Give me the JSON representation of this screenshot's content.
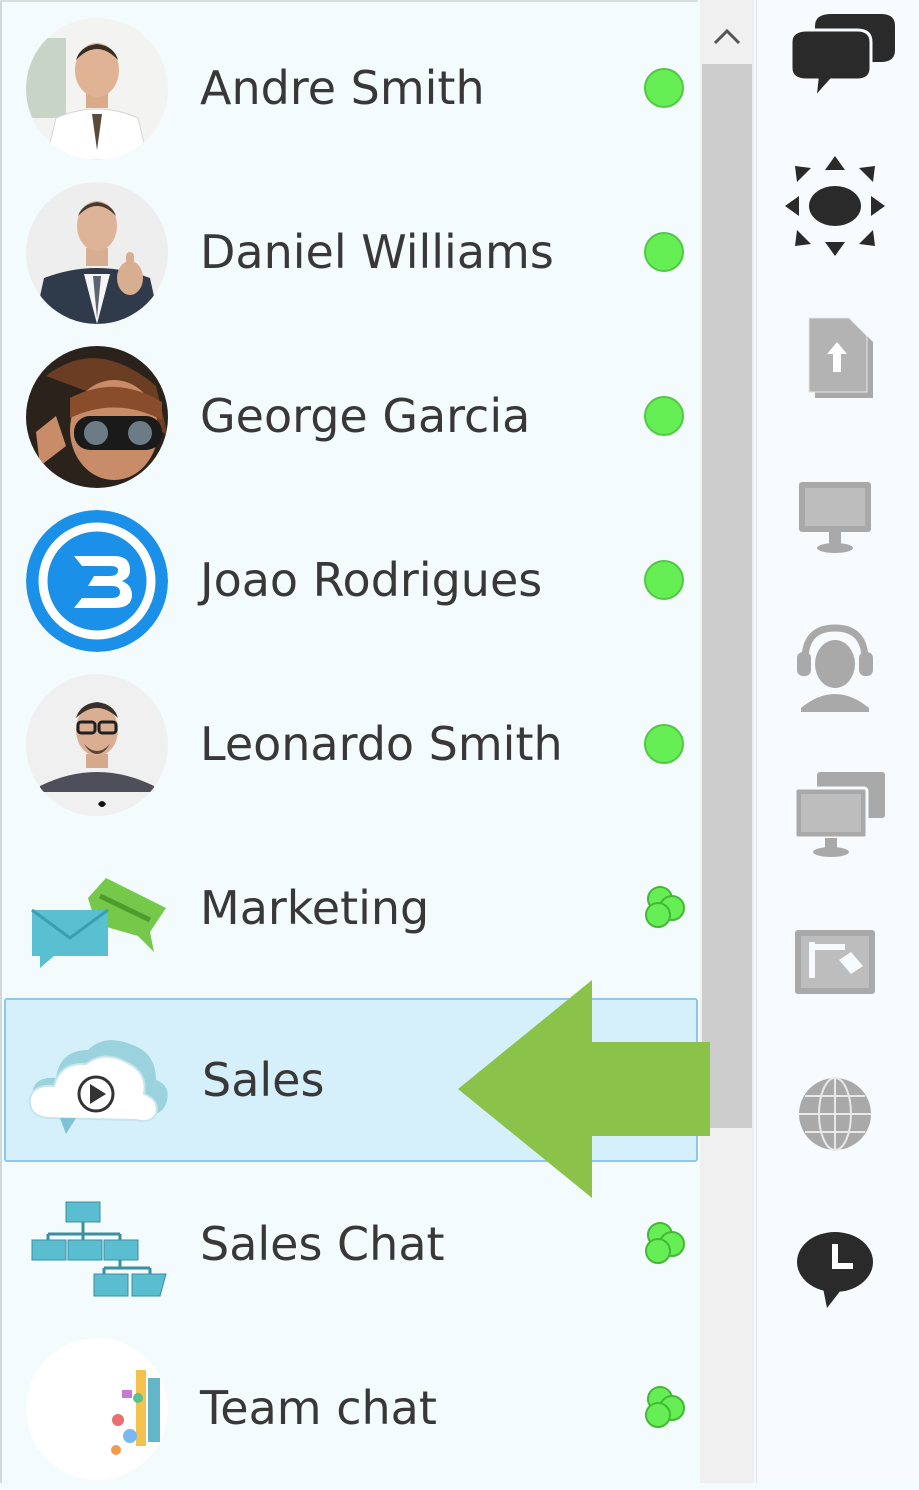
{
  "contacts": [
    {
      "name": "Andre Smith",
      "avatar_icon": "person-white-shirt-photo",
      "status": "online",
      "status_icon": "online-dot-icon"
    },
    {
      "name": "Daniel Williams",
      "avatar_icon": "person-suit-thumbs-up-photo",
      "status": "online",
      "status_icon": "online-dot-icon"
    },
    {
      "name": "George Garcia",
      "avatar_icon": "person-goggles-photo",
      "status": "online",
      "status_icon": "online-dot-icon"
    },
    {
      "name": "Joao Rodrigues",
      "avatar_icon": "blue-b-logo",
      "status": "online",
      "status_icon": "online-dot-icon"
    },
    {
      "name": "Leonardo Smith",
      "avatar_icon": "person-glasses-photo",
      "status": "online",
      "status_icon": "online-dot-icon"
    },
    {
      "name": "Marketing",
      "avatar_icon": "envelope-chat-icon",
      "status": "group",
      "status_icon": "group-dots-icon"
    },
    {
      "name": "Sales",
      "avatar_icon": "cloud-play-icon",
      "status": "selected",
      "status_icon": ""
    },
    {
      "name": "Sales Chat",
      "avatar_icon": "org-chart-icon",
      "status": "group",
      "status_icon": "group-dots-icon"
    },
    {
      "name": "Team chat",
      "avatar_icon": "team-illustration-icon",
      "status": "group",
      "status_icon": "group-dots-icon"
    }
  ],
  "toolbar": [
    {
      "icon": "chat-bubbles-icon",
      "active": true
    },
    {
      "icon": "expand-chat-icon",
      "active": true
    },
    {
      "icon": "file-upload-icon",
      "active": false
    },
    {
      "icon": "monitor-icon",
      "active": false
    },
    {
      "icon": "headset-agent-icon",
      "active": false
    },
    {
      "icon": "screen-share-icon",
      "active": false
    },
    {
      "icon": "whiteboard-icon",
      "active": false
    },
    {
      "icon": "globe-icon",
      "active": false
    },
    {
      "icon": "clock-chat-icon",
      "active": true
    }
  ],
  "colors": {
    "online": "#66ee55",
    "selection_bg": "#d6f0fb",
    "selection_border": "#8fc7ea",
    "pointer_arrow": "#8bc34a",
    "toolbar_active": "#2a2a2a",
    "toolbar_inactive": "#a9a9a9"
  }
}
